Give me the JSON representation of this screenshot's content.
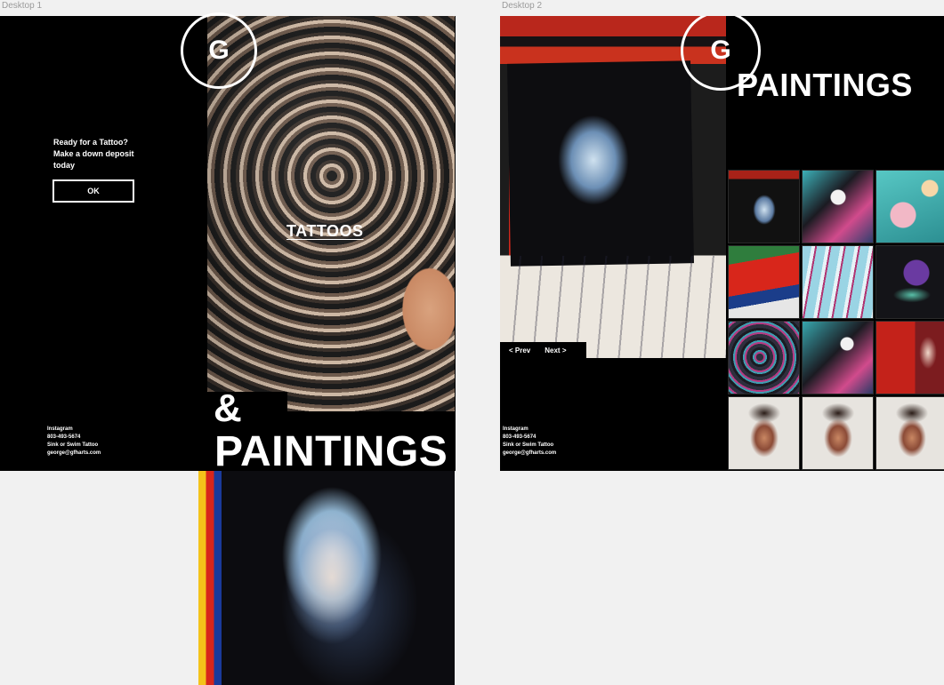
{
  "artboards": {
    "desktop1_label": "Desktop 1",
    "desktop2_label": "Desktop 2"
  },
  "desktop1": {
    "logo": "G",
    "cta": {
      "line1": "Ready for a Tattoo?",
      "line2": "Make a down deposit",
      "line3": "today",
      "button": "OK"
    },
    "tattoos_link": "TATTOOS",
    "amp": "&",
    "paintings_title": "PAINTINGS",
    "footer": {
      "instagram": "Instagram",
      "phone": "803-493-5674",
      "studio": "Sink or Swim Tattoo",
      "email": "george@gfharts.com"
    },
    "hero_image": "tattooed-head-photo",
    "lower_image": "portrait-painting"
  },
  "desktop2": {
    "logo": "G",
    "title": "PAINTINGS",
    "pager": {
      "prev": "< Prev",
      "next": "Next >"
    },
    "footer": {
      "instagram": "Instagram",
      "phone": "803-493-5674",
      "studio": "Sink or Swim Tattoo",
      "email": "george@gfharts.com"
    },
    "hero_image": "portrait-painting-on-red-canvas",
    "thumbnails": [
      "portrait-red",
      "skull-serpent",
      "roses-teal",
      "abstract-red-green",
      "cyan-drip",
      "purple-grapes-snake",
      "lettering-pink",
      "skull-serpent-2",
      "red-figure",
      "face-1",
      "face-2",
      "face-3"
    ]
  },
  "colors": {
    "background": "#f1f1f1",
    "artboard": "#000000",
    "text": "#ffffff"
  }
}
